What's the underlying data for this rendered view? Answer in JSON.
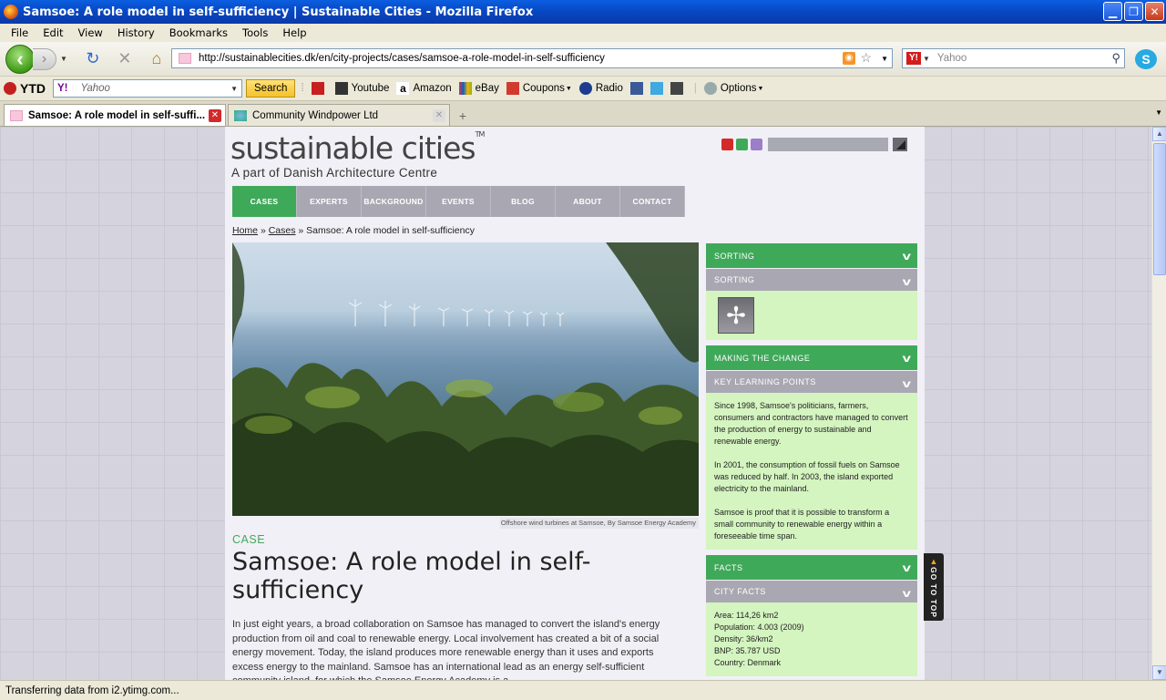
{
  "window": {
    "title": "Samsoe: A role model in self-sufficiency | Sustainable Cities - Mozilla Firefox"
  },
  "menu": [
    "File",
    "Edit",
    "View",
    "History",
    "Bookmarks",
    "Tools",
    "Help"
  ],
  "navbar": {
    "url": "http://sustainablecities.dk/en/city-projects/cases/samsoe-a-role-model-in-self-sufficiency",
    "search_placeholder": "Yahoo"
  },
  "toolbar2": {
    "ytd_label": "YTD",
    "yahoo_placeholder": "Yahoo",
    "search_button": "Search",
    "items": [
      "Youtube",
      "Amazon",
      "eBay",
      "Coupons",
      "Radio"
    ],
    "options": "Options"
  },
  "tabs": [
    {
      "label": "Samsoe: A role model in self-suffi..."
    },
    {
      "label": "Community Windpower Ltd"
    }
  ],
  "status": "Transferring data from i2.ytimg.com...",
  "site": {
    "logo": "sustainable cities",
    "logo_tm": "TM",
    "tagline": "A part of Danish Architecture Centre",
    "nav": [
      "CASES",
      "EXPERTS",
      "BACKGROUND",
      "EVENTS",
      "BLOG",
      "ABOUT",
      "CONTACT"
    ],
    "breadcrumb": {
      "home": "Home",
      "sep1": "»",
      "cases": "Cases",
      "sep2": "»",
      "current": "Samsoe: A role model in self-sufficiency"
    }
  },
  "article": {
    "caption": "Offshore wind turbines at Samsoe, By Samsoe Energy Academy",
    "kicker": "CASE",
    "headline": "Samsoe: A role model in self-sufficiency",
    "intro": "In just eight years, a broad collaboration on Samsoe has managed to convert the island's energy production from oil and coal to renewable energy. Local involvement has created a bit of a social energy movement. Today, the island produces more renewable energy than it uses and exports excess energy to the mainland. Samsoe has an international lead as an energy self-sufficient community island, for which the Samsoe Energy Academy is a..."
  },
  "sidebar": {
    "sorting_header": "SORTING",
    "sorting_sub": "SORTING",
    "change_header": "MAKING THE CHANGE",
    "learning_sub": "KEY LEARNING POINTS",
    "learning_points": [
      "Since 1998, Samsoe's politicians, farmers, consumers and contractors have managed to convert the production of energy to sustainable and renewable energy.",
      "In 2001, the consumption of fossil fuels on Samsoe was reduced by half. In 2003, the island exported electricity to the mainland.",
      "Samsoe is proof that it is possible to transform a small community to renewable energy within a foreseeable time span."
    ],
    "facts_header": "FACTS",
    "city_facts_sub": "CITY FACTS",
    "city_facts": [
      "Area: 114,26 km2",
      "Population: 4.003 (2009)",
      "Density: 36/km2",
      "BNP: 35.787 USD",
      "Country: Denmark"
    ]
  },
  "goto_top": "GO TO TOP"
}
